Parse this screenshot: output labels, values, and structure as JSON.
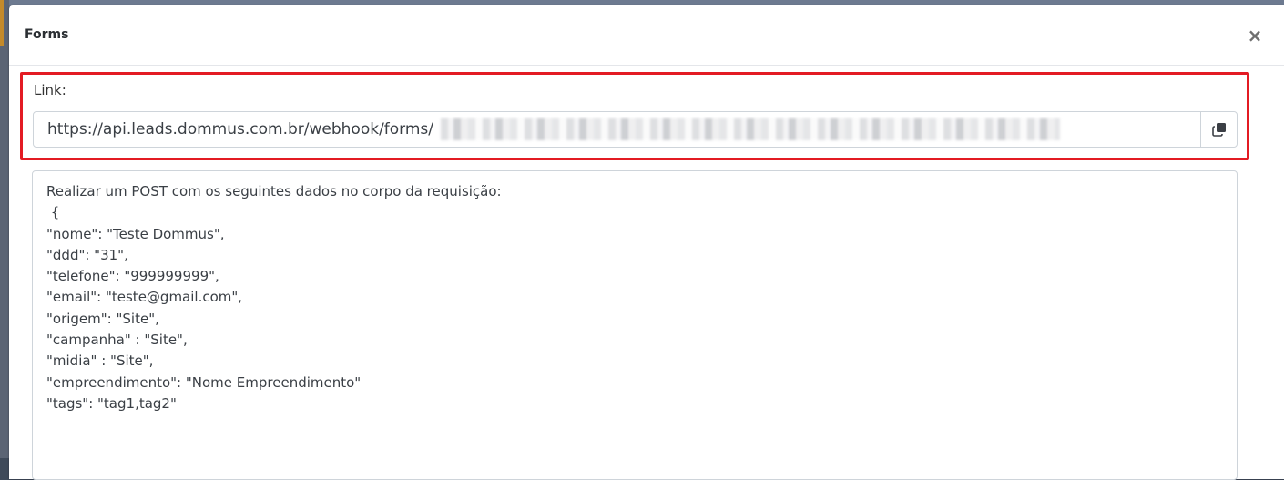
{
  "modal": {
    "title": "Forms",
    "close_icon": "close-icon",
    "close_glyph": "×"
  },
  "link": {
    "label": "Link:",
    "url_visible": "https://api.leads.dommus.com.br/webhook/forms/",
    "url_token_redacted": true,
    "copy_icon": "copy-icon"
  },
  "payload": {
    "lines": [
      "Realizar um POST com os seguintes dados no corpo da requisição:",
      " {",
      "\"nome\": \"Teste Dommus\",",
      "\"ddd\": \"31\",",
      "\"telefone\": \"999999999\",",
      "\"email\": \"teste@gmail.com\",",
      "\"origem\": \"Site\",",
      "\"campanha\" : \"Site\",",
      "\"midia\" : \"Site\",",
      "\"empreendimento\": \"Nome Empreendimento\"",
      "\"tags\": \"tag1,tag2\""
    ]
  },
  "colors": {
    "highlight_border": "#e31b23",
    "input_border": "#ced4da"
  }
}
